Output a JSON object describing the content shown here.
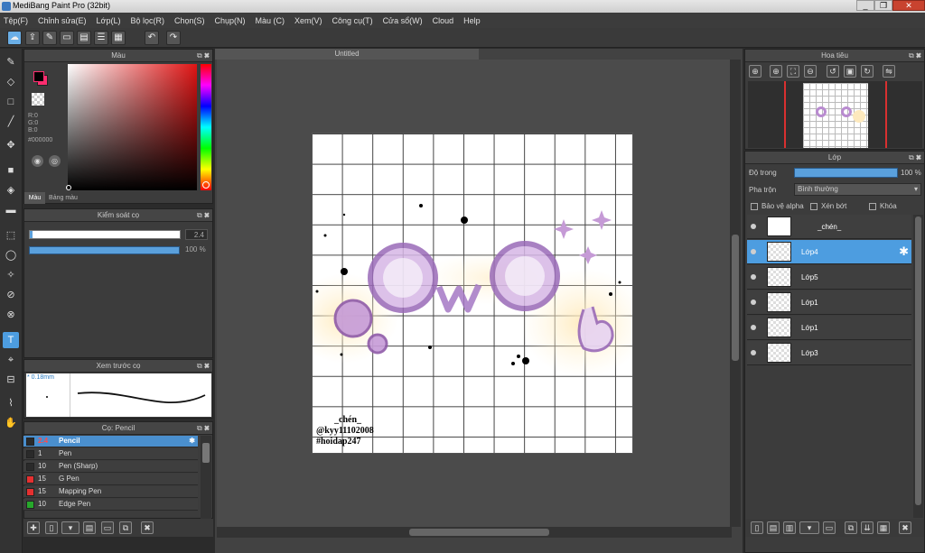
{
  "window": {
    "title": "MediBang Paint Pro (32bit)"
  },
  "menu": [
    "Tệp(F)",
    "Chỉnh sửa(E)",
    "Lớp(L)",
    "Bộ lọc(R)",
    "Chọn(S)",
    "Chụp(N)",
    "Màu (C)",
    "Xem(V)",
    "Công cụ(T)",
    "Cửa sổ(W)",
    "Cloud",
    "Help"
  ],
  "color_panel": {
    "title": "Màu",
    "r": "R:0",
    "g": "G:0",
    "b": "B:0",
    "hex": "#000000",
    "tab_color": "Màu",
    "tab_palette": "Bảng màu",
    "primary": "#000000",
    "secondary": "#ff2d6f"
  },
  "brush_control": {
    "title": "Kiểm soát cọ",
    "size": "2.4",
    "opacity": "100 %",
    "opacity_fraction": 1.0,
    "size_fraction": 0.02
  },
  "brush_preview": {
    "title": "Xem trước cọ",
    "size_label": "* 0.18mm"
  },
  "brush_list": {
    "title": "Cọ: Pencil",
    "items": [
      {
        "size": "2.4",
        "name": "Pencil",
        "color": "#2a2a2a"
      },
      {
        "size": "1",
        "name": "Pen",
        "color": "#2a2a2a"
      },
      {
        "size": "10",
        "name": "Pen (Sharp)",
        "color": "#2a2a2a"
      },
      {
        "size": "15",
        "name": "G Pen",
        "color": "#e53030"
      },
      {
        "size": "15",
        "name": "Mapping Pen",
        "color": "#e53030"
      },
      {
        "size": "10",
        "name": "Edge Pen",
        "color": "#27a82b"
      }
    ]
  },
  "canvas": {
    "tab": "Untitled",
    "signature_line1": "_chén_",
    "signature_line2": "@kyy11102008",
    "signature_line3": "#hoidap247"
  },
  "navigator": {
    "title": "Hoa tiêu"
  },
  "layers": {
    "title": "Lớp",
    "opacity_label": "Độ trong",
    "opacity_value": "100 %",
    "opacity_fraction": 1.0,
    "blend_label": "Pha trộn",
    "blend_value": "Bình thường",
    "protect_alpha": "Bảo vệ alpha",
    "clip": "Xén bớt",
    "lock": "Khóa",
    "items": [
      {
        "name": "_chén_"
      },
      {
        "name": "Lớp4"
      },
      {
        "name": "Lớp5"
      },
      {
        "name": "Lớp1"
      },
      {
        "name": "Lớp1"
      },
      {
        "name": "Lớp3"
      }
    ]
  }
}
